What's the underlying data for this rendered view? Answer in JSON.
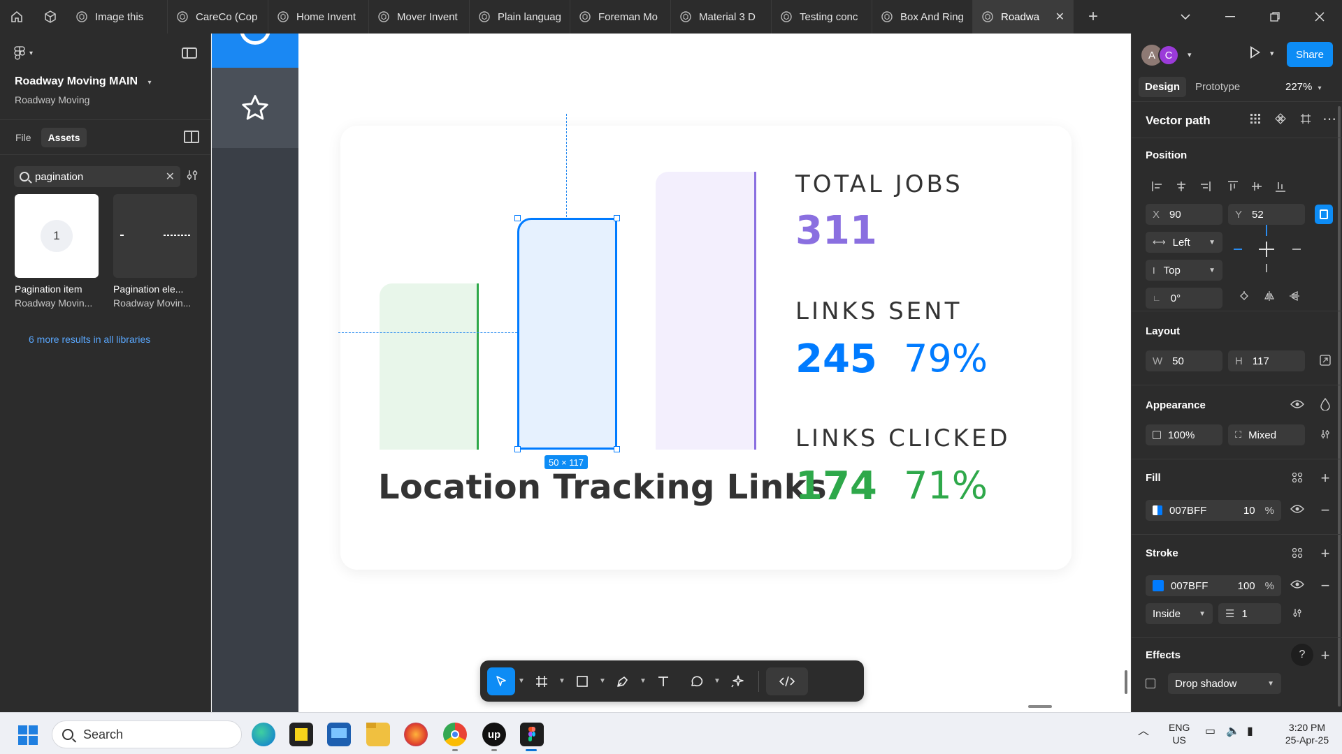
{
  "tabbar": {
    "tabs": [
      {
        "label": "Image this",
        "active": false
      },
      {
        "label": "CareCo (Cop",
        "active": false
      },
      {
        "label": "Home Invent",
        "active": false
      },
      {
        "label": "Mover Invent",
        "active": false
      },
      {
        "label": "Plain languag",
        "active": false
      },
      {
        "label": "Foreman Mo",
        "active": false
      },
      {
        "label": "Material 3 D",
        "active": false
      },
      {
        "label": "Testing conc",
        "active": false
      },
      {
        "label": "Box And Ring",
        "active": false
      },
      {
        "label": "Roadwa",
        "active": true
      }
    ],
    "close_glyph": "✕",
    "new_tab_glyph": "+"
  },
  "left_panel": {
    "file_title": "Roadway Moving MAIN",
    "file_subtitle": "Roadway Moving",
    "tabs": {
      "file": "File",
      "assets": "Assets"
    },
    "search": {
      "value": "pagination",
      "placeholder": ""
    },
    "assets": [
      {
        "name": "Pagination item",
        "library": "Roadway Movin...",
        "thumb_label": "1"
      },
      {
        "name": "Pagination ele...",
        "library": "Roadway Movin..."
      }
    ],
    "more_results": "6 more results in all libraries"
  },
  "canvas": {
    "dimension_badge": "50 × 117",
    "chart_title": "Location Tracking Links",
    "stats": {
      "total_jobs_label": "TOTAL JOBS",
      "total_jobs_value": "311",
      "links_sent_label": "LINKS SENT",
      "links_sent_value": "245",
      "links_sent_pct": "79%",
      "links_clicked_label": "LINKS CLICKED",
      "links_clicked_value": "174",
      "links_clicked_pct": "71%"
    },
    "colors": {
      "purple": "#8a6fe0",
      "blue": "#007bff",
      "green": "#2ea84a",
      "selection": "#0d8cf5"
    }
  },
  "right_panel": {
    "avatars": [
      "A",
      "C"
    ],
    "avatar_colors": [
      "#8e7a74",
      "#9b3bd9"
    ],
    "share_label": "Share",
    "tabs": {
      "design": "Design",
      "prototype": "Prototype"
    },
    "zoom": "227%",
    "layer_type": "Vector path",
    "position": {
      "title": "Position",
      "x_label": "X",
      "x": "90",
      "y_label": "Y",
      "y": "52",
      "h_constraint": "Left",
      "v_constraint": "Top",
      "rotation": "0°"
    },
    "layout": {
      "title": "Layout",
      "w_label": "W",
      "w": "50",
      "h_label": "H",
      "h": "117"
    },
    "appearance": {
      "title": "Appearance",
      "opacity": "100%",
      "radius": "Mixed"
    },
    "fill": {
      "title": "Fill",
      "color": "007BFF",
      "opacity": "10",
      "unit": "%"
    },
    "stroke": {
      "title": "Stroke",
      "color": "007BFF",
      "opacity": "100",
      "unit": "%",
      "position": "Inside",
      "weight": "1"
    },
    "effects": {
      "title": "Effects",
      "item": "Drop shadow",
      "help": "?"
    }
  },
  "taskbar": {
    "search_label": "Search",
    "lang_line1": "ENG",
    "lang_line2": "US",
    "time": "3:20 PM",
    "date": "25-Apr-25"
  }
}
